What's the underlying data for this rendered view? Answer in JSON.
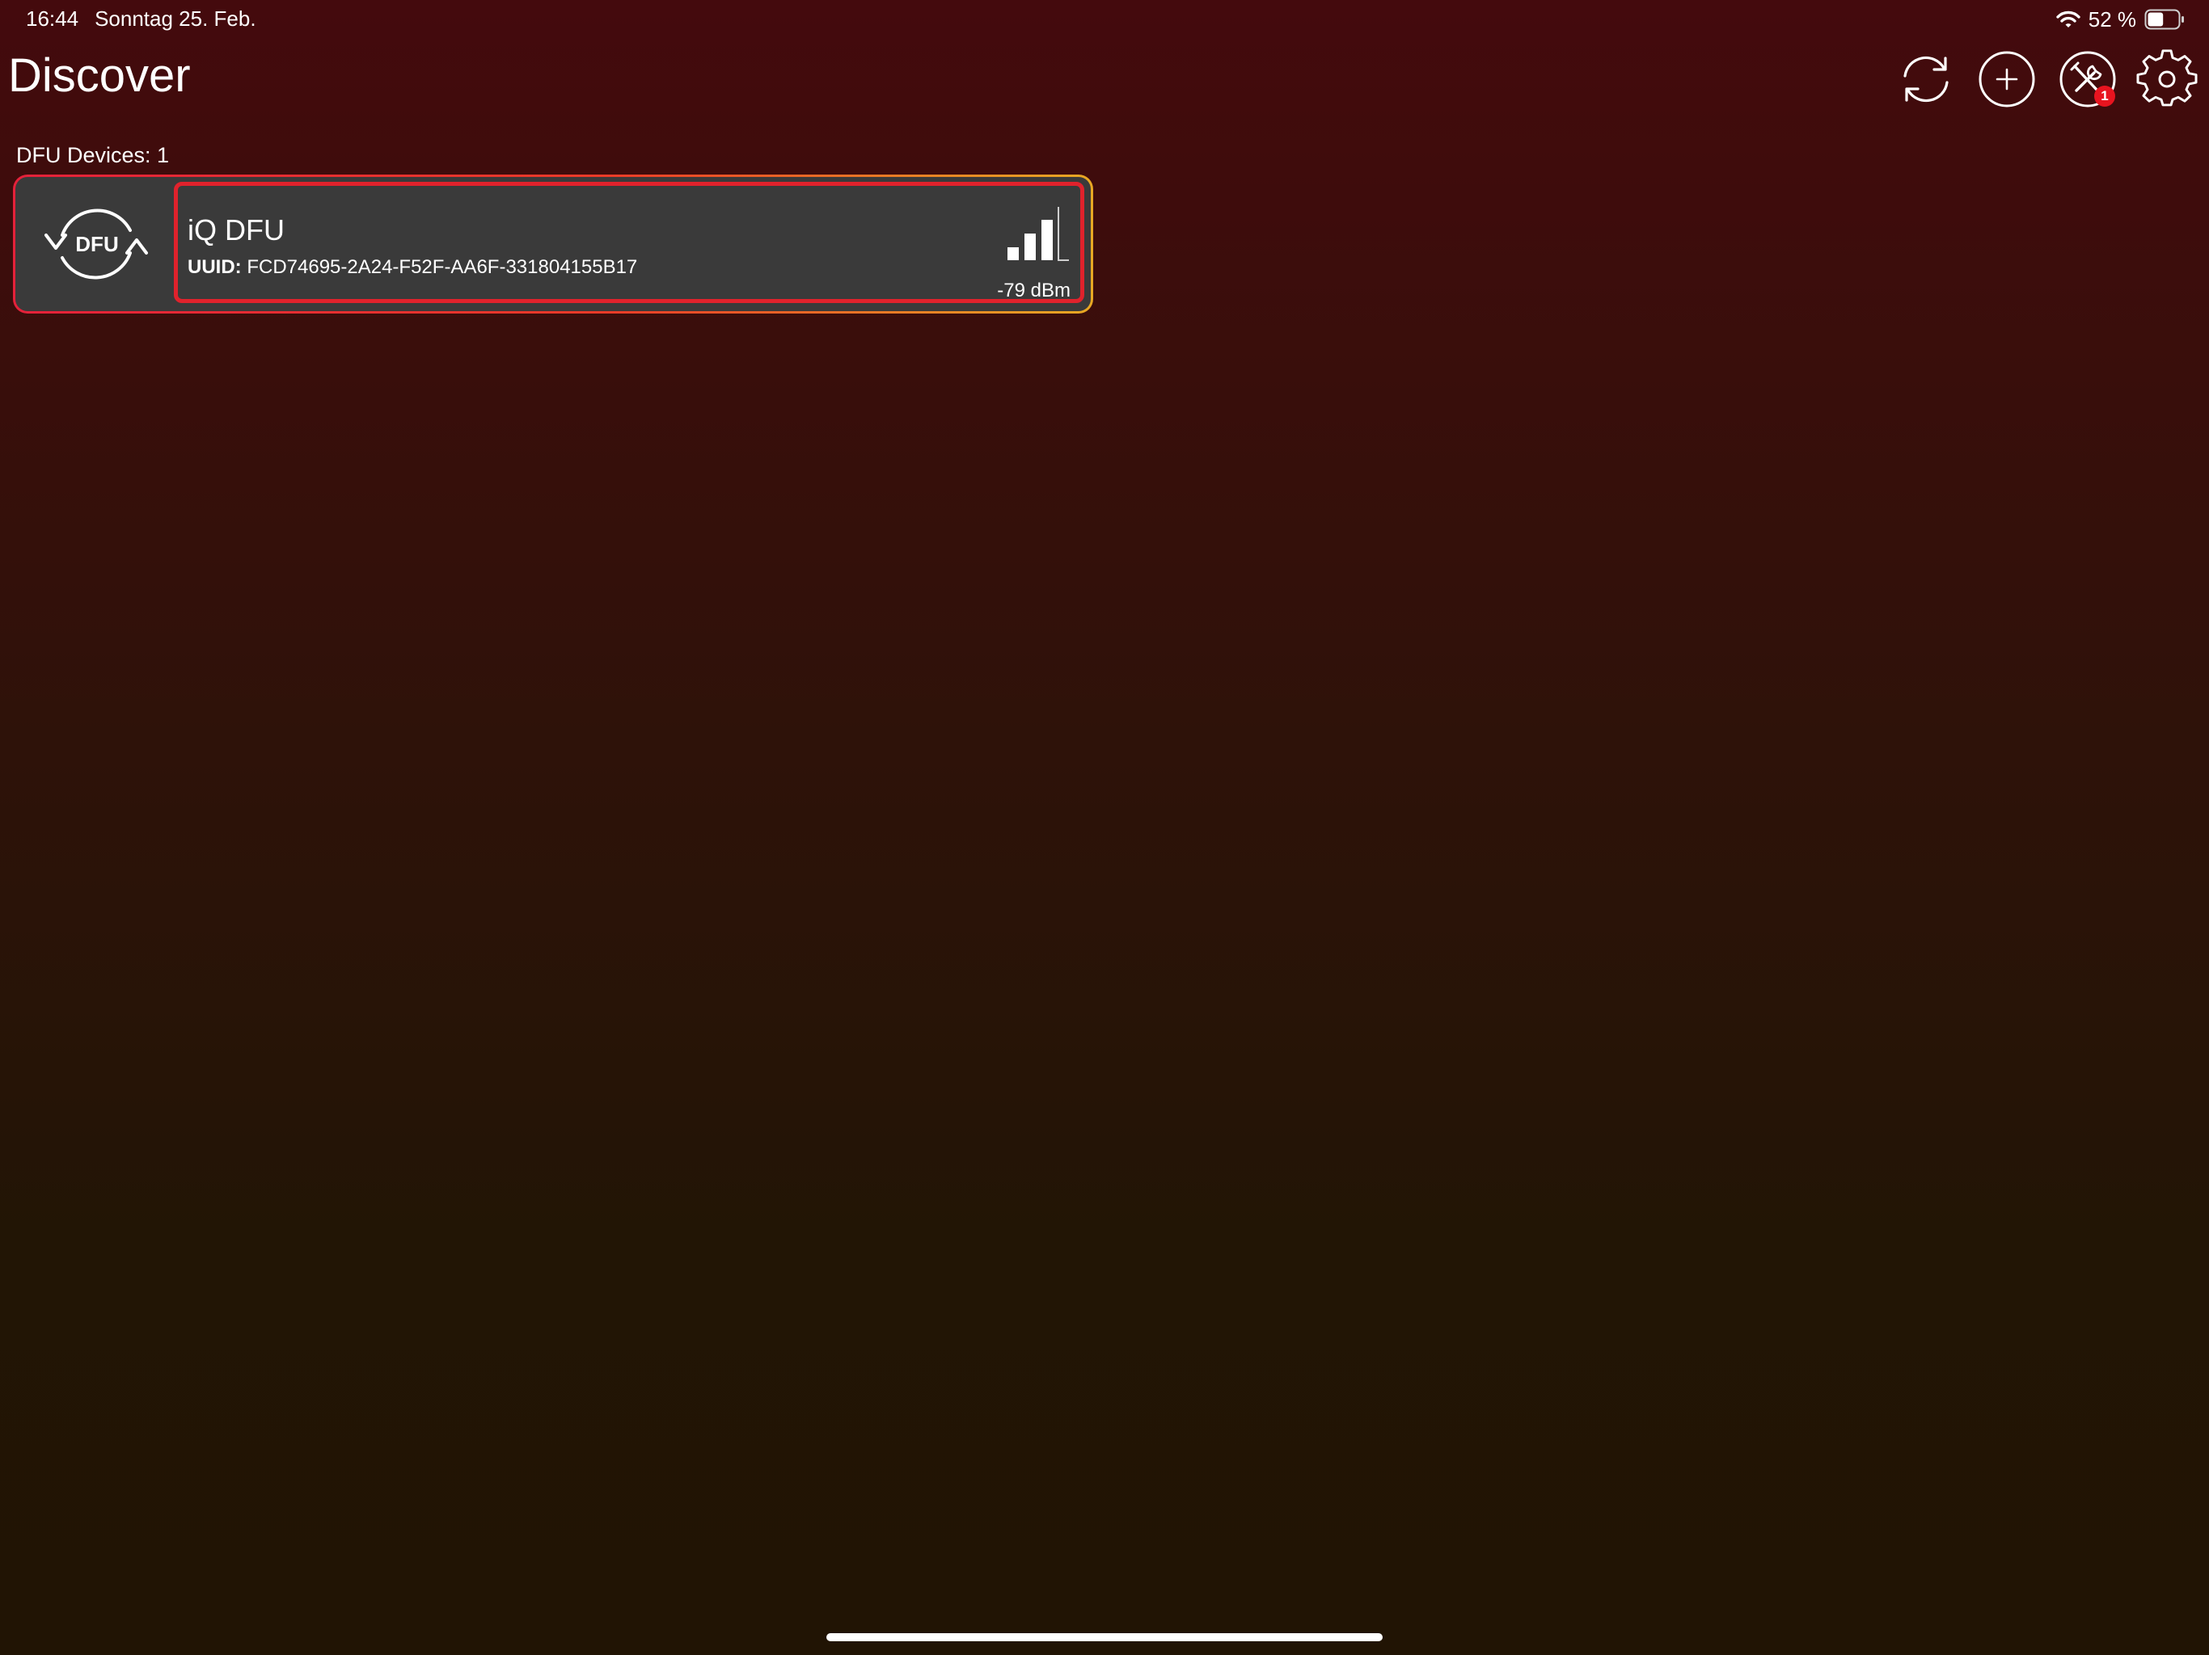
{
  "status_bar": {
    "time": "16:44",
    "date": "Sonntag 25. Feb.",
    "battery_percent": "52 %",
    "battery_level": 0.52,
    "wifi_icon": "wifi-icon",
    "battery_icon": "battery-icon"
  },
  "header": {
    "title": "Discover",
    "toolbar": [
      {
        "name": "refresh-button",
        "icon": "refresh-icon"
      },
      {
        "name": "add-button",
        "icon": "plus-circle-icon"
      },
      {
        "name": "tools-button",
        "icon": "tools-icon",
        "badge": "1"
      },
      {
        "name": "settings-button",
        "icon": "gear-icon"
      }
    ]
  },
  "devices": {
    "section_label": "DFU Devices: 1",
    "items": [
      {
        "icon": "dfu-icon",
        "icon_text": "DFU",
        "name": "iQ DFU",
        "uuid_label": "UUID:",
        "uuid": "FCD74695-2A24-F52F-AA6F-331804155B17",
        "rssi": "-79 dBm",
        "signal_bars_filled": 3,
        "signal_bars_total": 4
      }
    ]
  },
  "colors": {
    "background_top": "#440a0d",
    "background_bottom": "#211404",
    "card_background": "#3a3a3a",
    "selection_border": "#e0222c",
    "card_border_accent": "#e8a823",
    "badge": "#e8141f"
  }
}
